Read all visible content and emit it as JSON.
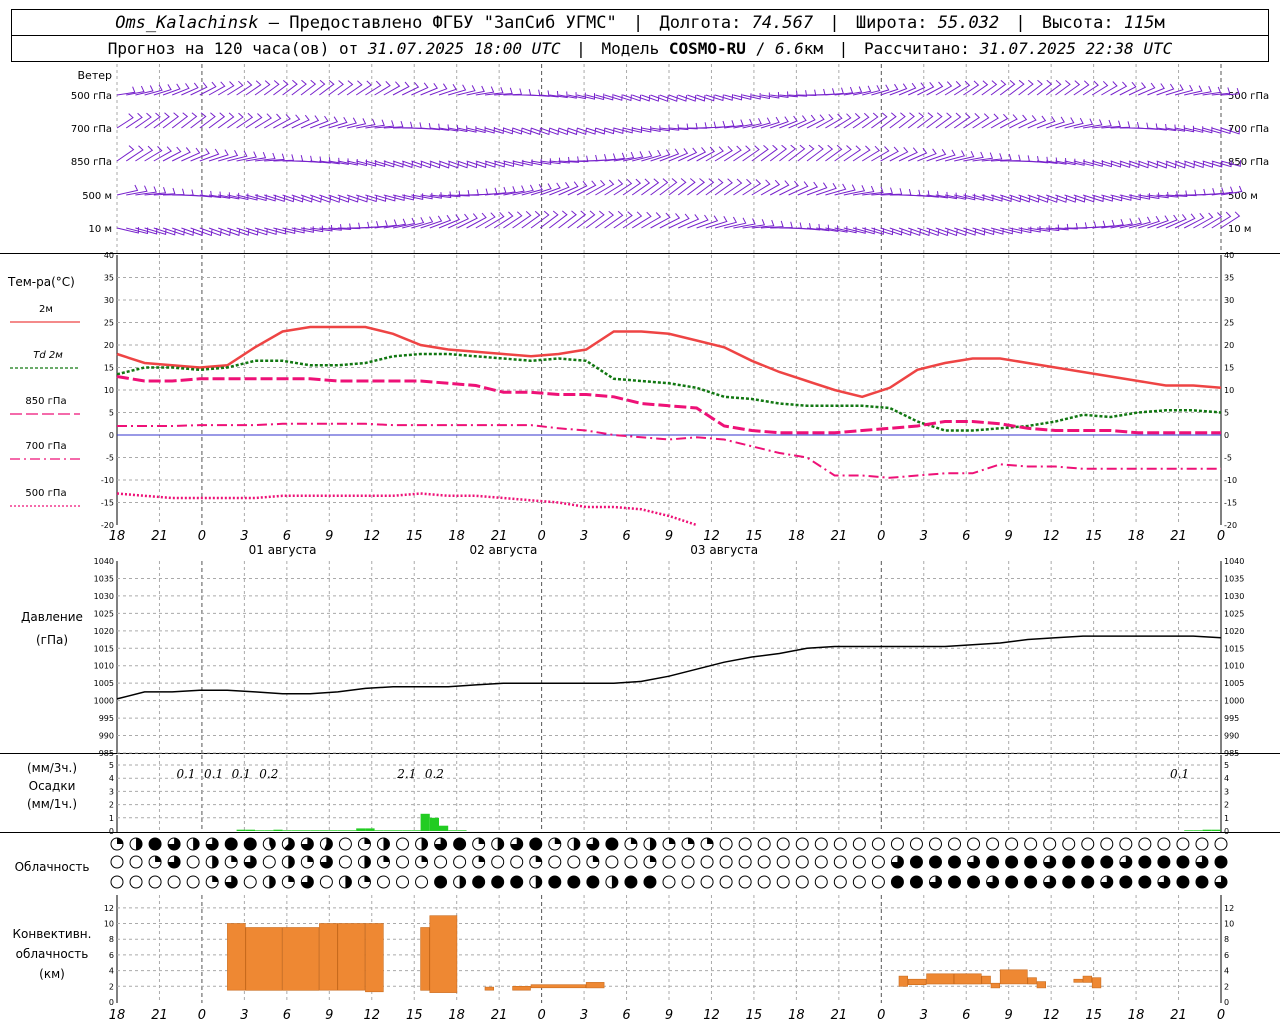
{
  "header": {
    "station": "Oms_Kalachinsk",
    "dash": "–",
    "provider": "Предоставлено ФГБУ \"ЗапСиб УГМС\"",
    "lon_label": "Долгота:",
    "lon_value": "74.567",
    "lat_label": "Широта:",
    "lat_value": "55.032",
    "alt_label": "Высота:",
    "alt_value": "115",
    "alt_unit": "м",
    "forecast_label": "Прогноз на 120 часа(ов) от",
    "forecast_from": "31.07.2025 18:00 UTC",
    "model_label": "Модель",
    "model_name": "COSMO-RU",
    "model_res": "6.6",
    "model_res_unit": "км",
    "calc_label": "Рассчитано:",
    "calc_time": "31.07.2025 22:38 UTC"
  },
  "x_axis": {
    "hour_labels": [
      "18",
      "21",
      "0",
      "3",
      "6",
      "9",
      "12",
      "15",
      "18",
      "21",
      "0",
      "3",
      "6",
      "9",
      "12",
      "15",
      "18",
      "21",
      "0",
      "3",
      "6",
      "9",
      "12",
      "15",
      "18",
      "21",
      "0"
    ],
    "day_labels": [
      "01 августа",
      "02 августа",
      "03 августа"
    ]
  },
  "wind": {
    "title": "Ветер",
    "levels": [
      "500 гПа",
      "700 гПа",
      "850 гПа",
      "500 м",
      "10 м"
    ],
    "color": "#7722cc"
  },
  "temperature": {
    "title": "Тем-ра(°C)",
    "legend": [
      "2м",
      "Td 2м",
      "850 гПа",
      "700 гПа",
      "500 гПа"
    ],
    "y_ticks": [
      "40",
      "35",
      "30",
      "25",
      "20",
      "15",
      "10",
      "5",
      "0",
      "-5",
      "-10",
      "-15",
      "-20"
    ]
  },
  "pressure": {
    "title": "Давление",
    "unit": "(гПа)",
    "y_ticks": [
      "1040",
      "1035",
      "1030",
      "1025",
      "1020",
      "1015",
      "1010",
      "1005",
      "1000",
      "995",
      "990",
      "985"
    ]
  },
  "precip": {
    "unit3": "(мм/3ч.)",
    "title": "Осадки",
    "unit1": "(мм/1ч.)",
    "y_ticks": [
      "5",
      "4",
      "3",
      "2",
      "1",
      "0"
    ],
    "labels": [
      {
        "hour": 9,
        "text": "0.1"
      },
      {
        "hour": 12,
        "text": "0.1"
      },
      {
        "hour": 15,
        "text": "0.1"
      },
      {
        "hour": 18,
        "text": "0.2"
      },
      {
        "hour": 33,
        "text": "2.1"
      },
      {
        "hour": 36,
        "text": "0.2"
      },
      {
        "hour": 117,
        "text": "0.1"
      }
    ]
  },
  "clouds": {
    "title": "Облачность"
  },
  "convective": {
    "title1": "Конвективн.",
    "title2": "облачность",
    "unit": "(км)",
    "y_ticks": [
      "12",
      "10",
      "8",
      "6",
      "4",
      "2",
      "0"
    ]
  },
  "colors": {
    "t2m": "#ee4444",
    "td2m": "#117711",
    "t850": "#ee1177",
    "t700": "#ee1177",
    "t500": "#ee1177",
    "pressure": "#000000",
    "precip": "#22cc22",
    "convective": "#ee8833",
    "zero_line": "#3333cc"
  },
  "chart_data": [
    {
      "type": "line",
      "title": "Тем-ра(°C)",
      "x_hours_from_start": [
        0,
        3,
        6,
        9,
        12,
        15,
        18,
        21,
        24,
        27,
        30,
        33,
        36,
        39,
        42,
        45,
        48,
        51,
        54,
        57,
        60,
        63,
        66,
        69,
        72,
        75,
        78,
        81,
        84,
        87,
        90,
        93,
        96,
        99,
        102,
        105,
        108,
        111,
        114,
        117,
        120
      ],
      "ylim": [
        -20,
        40
      ],
      "series": [
        {
          "name": "2м",
          "values": [
            18,
            16,
            15.5,
            15,
            15.5,
            19.5,
            23,
            24,
            24,
            24,
            22.5,
            20,
            19,
            18.5,
            18,
            17.5,
            18,
            19,
            23,
            23,
            22.5,
            21,
            19.5,
            16.5,
            14,
            12,
            10,
            8.5,
            10.5,
            14.5,
            16,
            17,
            17,
            16,
            15,
            14,
            13,
            12,
            11,
            11,
            10.5
          ]
        },
        {
          "name": "Td 2м",
          "values": [
            13.5,
            15,
            15,
            14.5,
            15,
            16.5,
            16.5,
            15.5,
            15.5,
            16,
            17.5,
            18,
            18,
            17.5,
            17,
            16.5,
            17,
            16.5,
            12.5,
            12,
            11.5,
            10.5,
            8.5,
            8,
            7,
            6.5,
            6.5,
            6.5,
            6,
            3,
            1,
            1,
            1.5,
            2,
            3,
            4.5,
            4,
            5,
            5.5,
            5.5,
            5
          ]
        },
        {
          "name": "850 гПа",
          "values": [
            13,
            12,
            12,
            12.5,
            12.5,
            12.5,
            12.5,
            12.5,
            12,
            12,
            12,
            12,
            11.5,
            11,
            9.5,
            9.5,
            9,
            9,
            8.5,
            7,
            6.5,
            6,
            2,
            1,
            0.5,
            0.5,
            0.5,
            1,
            1.5,
            2,
            3,
            3,
            2.5,
            1.5,
            1,
            1,
            1,
            0.5,
            0.5,
            0.5,
            0.5
          ]
        },
        {
          "name": "700 гПа",
          "values": [
            2,
            2,
            2,
            2.2,
            2.2,
            2.2,
            2.5,
            2.5,
            2.5,
            2.5,
            2.2,
            2.2,
            2.2,
            2.2,
            2.2,
            2.2,
            1.5,
            1,
            0,
            -0.5,
            -1,
            -0.5,
            -1,
            -2.5,
            -4,
            -5,
            -9,
            -9,
            -9.5,
            -9,
            -8.5,
            -8.5,
            -6.5,
            -7,
            -7,
            -7.5,
            -7.5,
            -7.5,
            -7.5,
            -7.5,
            -7.5
          ]
        },
        {
          "name": "500 гПа",
          "values": [
            -13,
            -13.5,
            -14,
            -14,
            -14,
            -14,
            -13.5,
            -13.5,
            -13.5,
            -13.5,
            -13.5,
            -13,
            -13.5,
            -13.5,
            -14,
            -14.5,
            -15,
            -16,
            -16,
            -16.5,
            -18,
            -20
          ]
        }
      ]
    },
    {
      "type": "line",
      "title": "Давление",
      "x_hours_from_start": [
        0,
        3,
        6,
        9,
        12,
        15,
        18,
        21,
        24,
        27,
        30,
        33,
        36,
        39,
        42,
        45,
        48,
        51,
        54,
        57,
        60,
        63,
        66,
        69,
        72,
        75,
        78,
        81,
        84,
        87,
        90,
        93,
        96,
        99,
        102,
        105,
        108,
        111,
        114,
        117,
        120
      ],
      "ylim": [
        985,
        1040
      ],
      "series": [
        {
          "name": "Давление",
          "values": [
            1000.5,
            1002.5,
            1002.5,
            1003,
            1003,
            1002.5,
            1002,
            1002,
            1002.5,
            1003.5,
            1004,
            1004,
            1004,
            1004.5,
            1005,
            1005,
            1005,
            1005,
            1005,
            1005.5,
            1007,
            1009,
            1011,
            1012.5,
            1013.5,
            1015,
            1015.5,
            1015.5,
            1015.5,
            1015.5,
            1015.5,
            1016,
            1016.5,
            1017.5,
            1018,
            1018.5,
            1018.5,
            1018.5,
            1018.5,
            1018.5,
            1018
          ]
        }
      ]
    },
    {
      "type": "bar",
      "title": "Осадки",
      "x_hours_from_start": [
        14,
        15,
        16,
        17,
        18,
        19,
        20,
        21,
        22,
        23,
        24,
        25,
        26,
        27,
        28,
        29,
        30,
        31,
        32,
        33,
        34,
        35,
        36,
        37,
        38,
        117,
        118,
        119,
        120
      ],
      "ylabel": "(мм/1ч.)",
      "ylim": [
        0,
        5
      ],
      "values": [
        0.1,
        0.1,
        0.05,
        0.05,
        0.1,
        0.05,
        0.05,
        0.05,
        0.05,
        0.05,
        0.05,
        0.05,
        0.05,
        0.2,
        0.2,
        0.05,
        0.05,
        0.05,
        0.05,
        0.05,
        1.3,
        1.0,
        0.4,
        0.05,
        0.05,
        0.05,
        0.05,
        0.1,
        0.1
      ]
    },
    {
      "type": "bar",
      "title": "Конвективн. облачность",
      "ylabel": "(км)",
      "ylim": [
        0,
        13
      ],
      "bars": [
        {
          "x0": 12,
          "x1": 14,
          "bottom": 1.5,
          "top": 10
        },
        {
          "x0": 14,
          "x1": 18,
          "bottom": 1.5,
          "top": 9.5
        },
        {
          "x0": 18,
          "x1": 22,
          "bottom": 1.5,
          "top": 9.5
        },
        {
          "x0": 22,
          "x1": 24,
          "bottom": 1.5,
          "top": 10
        },
        {
          "x0": 24,
          "x1": 27,
          "bottom": 1.5,
          "top": 10
        },
        {
          "x0": 27,
          "x1": 29,
          "bottom": 1.3,
          "top": 10
        },
        {
          "x0": 33,
          "x1": 34,
          "bottom": 1.5,
          "top": 9.5
        },
        {
          "x0": 34,
          "x1": 37,
          "bottom": 1.2,
          "top": 11
        },
        {
          "x0": 40,
          "x1": 41,
          "bottom": 1.5,
          "top": 1.9
        },
        {
          "x0": 43,
          "x1": 45,
          "bottom": 1.5,
          "top": 2
        },
        {
          "x0": 45,
          "x1": 51,
          "bottom": 1.8,
          "top": 2.2
        },
        {
          "x0": 51,
          "x1": 53,
          "bottom": 1.8,
          "top": 2.5
        },
        {
          "x0": 85,
          "x1": 86,
          "bottom": 2,
          "top": 3.3
        },
        {
          "x0": 86,
          "x1": 88,
          "bottom": 2.2,
          "top": 2.9
        },
        {
          "x0": 88,
          "x1": 91,
          "bottom": 2.3,
          "top": 3.6
        },
        {
          "x0": 91,
          "x1": 94,
          "bottom": 2.3,
          "top": 3.6
        },
        {
          "x0": 94,
          "x1": 95,
          "bottom": 2.3,
          "top": 3.3
        },
        {
          "x0": 95,
          "x1": 96,
          "bottom": 1.8,
          "top": 2.4
        },
        {
          "x0": 96,
          "x1": 99,
          "bottom": 2.3,
          "top": 4.1
        },
        {
          "x0": 99,
          "x1": 100,
          "bottom": 2.3,
          "top": 3.1
        },
        {
          "x0": 100,
          "x1": 101,
          "bottom": 1.8,
          "top": 2.6
        },
        {
          "x0": 104,
          "x1": 105,
          "bottom": 2.5,
          "top": 2.9
        },
        {
          "x0": 105,
          "x1": 106,
          "bottom": 2.5,
          "top": 3.3
        },
        {
          "x0": 106,
          "x1": 107,
          "bottom": 1.8,
          "top": 3.1
        }
      ]
    }
  ]
}
